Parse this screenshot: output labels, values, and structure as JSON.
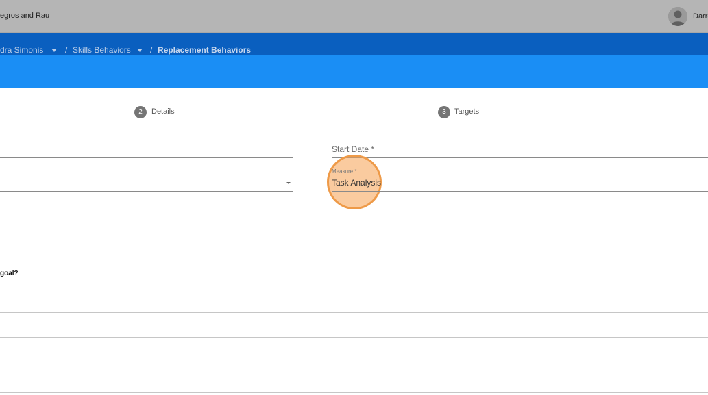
{
  "topbar": {
    "org_name": "egros and Rau",
    "user_name": "Darro"
  },
  "breadcrumb": {
    "items": [
      {
        "label": "dra Simonis"
      },
      {
        "label": "Skills Behaviors"
      },
      {
        "label": "Replacement Behaviors"
      }
    ],
    "separator": "/"
  },
  "stepper": {
    "steps": [
      {
        "number": "2",
        "label": "Details"
      },
      {
        "number": "3",
        "label": "Targets"
      }
    ]
  },
  "form": {
    "start_date_label": "Start Date *",
    "measure_label": "Measure *",
    "measure_value": "Task Analysis",
    "question_text": "goal?"
  },
  "colors": {
    "topbar": "#b5b5b5",
    "breadcrumb_bar": "#0a5fbf",
    "header_band": "#1a8ef5",
    "highlight": "#ee9a48"
  },
  "icons": {
    "avatar": "user-avatar-icon",
    "crumb_dropdown": "caret-down-icon",
    "select_arrow": "caret-down-icon"
  }
}
